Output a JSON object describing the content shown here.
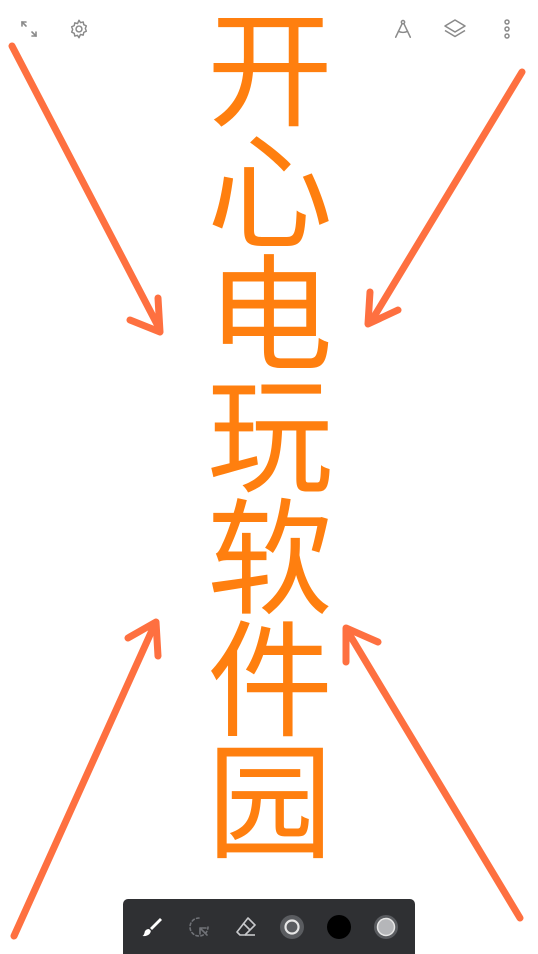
{
  "canvas": {
    "characters": [
      "开",
      "心",
      "电",
      "玩",
      "软",
      "件",
      "园"
    ],
    "text_color": "#ff7f0f",
    "arrow_color": "#fe7040",
    "background": "#ffffff"
  },
  "topbar": {
    "left_icons": [
      "fullscreen-icon",
      "settings-icon"
    ],
    "right_icons": [
      "ruler-compass-icon",
      "layers-icon",
      "more-vertical-icon"
    ],
    "icon_color": "#8a8a8a"
  },
  "toolbar": {
    "background": "#2f3033",
    "tools": [
      "brush-tool",
      "lasso-select-tool",
      "eraser-tool",
      "brush-size-tool",
      "color-swatch",
      "opacity-tool"
    ],
    "current_color": "#000000"
  }
}
